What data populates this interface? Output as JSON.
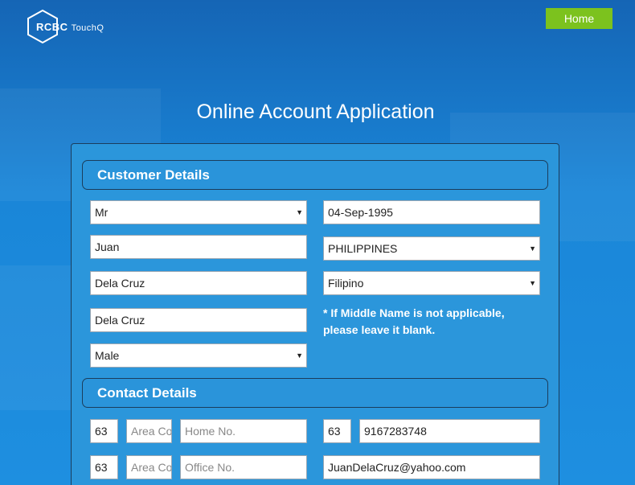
{
  "header": {
    "logo_text": "RCBC",
    "logo_sub": "TouchQ",
    "home_label": "Home"
  },
  "page_title": "Online Account Application",
  "customer_details": {
    "heading": "Customer Details",
    "title_select": "Mr",
    "first_name": "Juan",
    "middle_name": "Dela Cruz",
    "last_name": "Dela Cruz",
    "gender_select": "Male",
    "birthdate": "04-Sep-1995",
    "country_select": "PHILIPPINES",
    "nationality_select": "Filipino",
    "middle_name_note": "* If Middle Name is not applicable, please leave it blank."
  },
  "contact_details": {
    "heading": "Contact Details",
    "home_country_code": "63",
    "home_area_code_placeholder": "Area Code",
    "home_number_placeholder": "Home No.",
    "office_country_code": "63",
    "office_area_code_placeholder": "Area Code",
    "office_number_placeholder": "Office No.",
    "mobile_country_code": "63",
    "mobile_number": "9167283748",
    "email": "JuanDelaCruz@yahoo.com"
  },
  "colors": {
    "accent_green": "#7cc21e",
    "panel_blue": "#2b96db",
    "background_blue": "#1a86d8"
  }
}
